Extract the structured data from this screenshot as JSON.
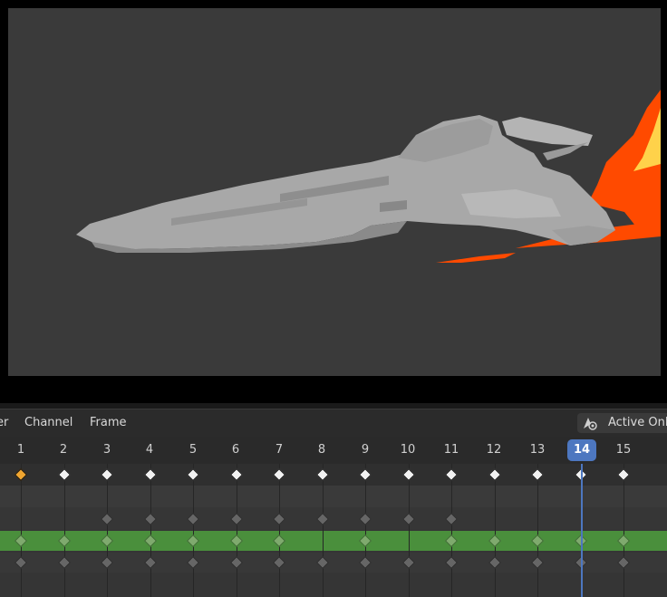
{
  "header": {
    "menu": [
      "er",
      "Channel",
      "Frame"
    ],
    "active_only_label": "Active Onl"
  },
  "ruler": {
    "frames": [
      "1",
      "2",
      "3",
      "4",
      "5",
      "6",
      "7",
      "8",
      "9",
      "10",
      "11",
      "12",
      "13",
      "14",
      "15"
    ],
    "current_frame": "14"
  },
  "keyframes": {
    "summary": [
      1,
      2,
      3,
      4,
      5,
      6,
      7,
      8,
      9,
      10,
      11,
      12,
      13,
      14,
      15
    ],
    "summary_selected": [
      1
    ],
    "channel_b": [
      3,
      4,
      5,
      6,
      7,
      8,
      9,
      10,
      11
    ],
    "channel_green": [
      1,
      2,
      3,
      4,
      5,
      6,
      7,
      9,
      11,
      12,
      13,
      14,
      15
    ],
    "channel_c": [
      1,
      2,
      3,
      4,
      5,
      6,
      7,
      8,
      9,
      10,
      11,
      12,
      13,
      14,
      15
    ]
  },
  "colors": {
    "accent": "#4d77c0",
    "selected_channel": "#4a8f3c",
    "flame": "#ff4a00",
    "ship": "#a8a8a8"
  },
  "icons": {
    "active_only": "shape-keys-icon"
  }
}
